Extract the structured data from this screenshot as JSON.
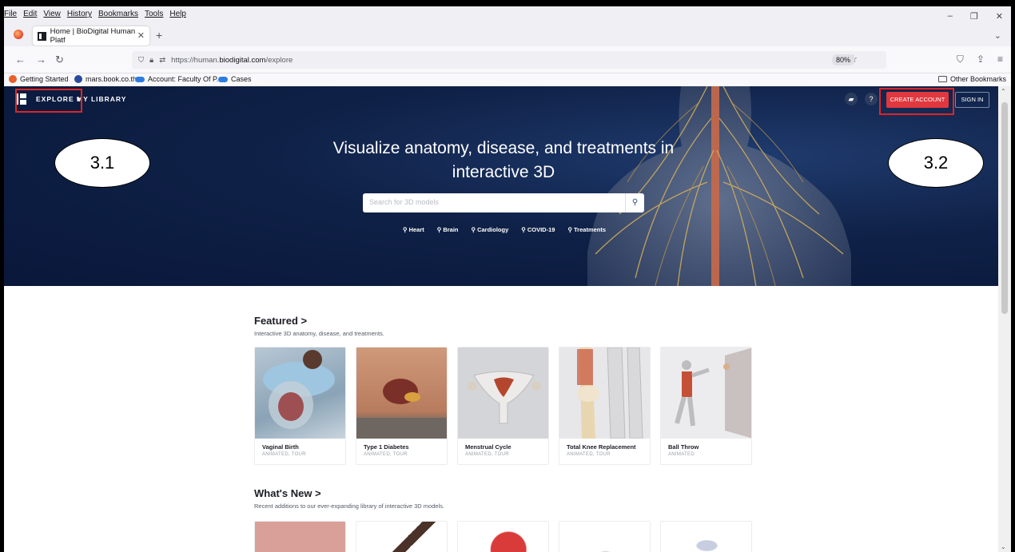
{
  "browser": {
    "menu": [
      "File",
      "Edit",
      "View",
      "History",
      "Bookmarks",
      "Tools",
      "Help"
    ],
    "tab_title": "Home | BioDigital Human Platf",
    "url_prefix": "https://human.",
    "url_domain": "biodigital.com",
    "url_path": "/explore",
    "zoom": "80%",
    "bookmarks": [
      "Getting Started",
      "mars.book.co.th",
      "Account: Faculty Of P...",
      "Cases"
    ],
    "other_bookmarks": "Other Bookmarks"
  },
  "site_nav": {
    "explore": "EXPLORE ▾",
    "library": "MY LIBRARY",
    "help": "?",
    "create_account": "CREATE ACCOUNT",
    "sign_in": "SIGN IN"
  },
  "callouts": {
    "left": "3.1",
    "right": "3.2"
  },
  "hero": {
    "title": "Visualize anatomy, disease, and treatments in interactive 3D",
    "search_placeholder": "Search for 3D models",
    "chips": [
      "Heart",
      "Brain",
      "Cardiology",
      "COVID-19",
      "Treatments"
    ]
  },
  "featured": {
    "title": "Featured >",
    "subtitle": "Interactive 3D anatomy, disease, and treatments.",
    "cards": [
      {
        "name": "Vaginal Birth",
        "tags": "ANIMATED, TOUR"
      },
      {
        "name": "Type 1 Diabetes",
        "tags": "ANIMATED, TOUR"
      },
      {
        "name": "Menstrual Cycle",
        "tags": "ANIMATED, TOUR"
      },
      {
        "name": "Total Knee Replacement",
        "tags": "ANIMATED, TOUR"
      },
      {
        "name": "Ball Throw",
        "tags": "ANIMATED"
      }
    ]
  },
  "whats_new": {
    "title": "What's New >",
    "subtitle": "Recent additions to our ever-expanding library of interactive 3D models."
  },
  "colors": {
    "hero": "#0f2147",
    "accent": "#e0383e",
    "highlight": "#e02424"
  }
}
